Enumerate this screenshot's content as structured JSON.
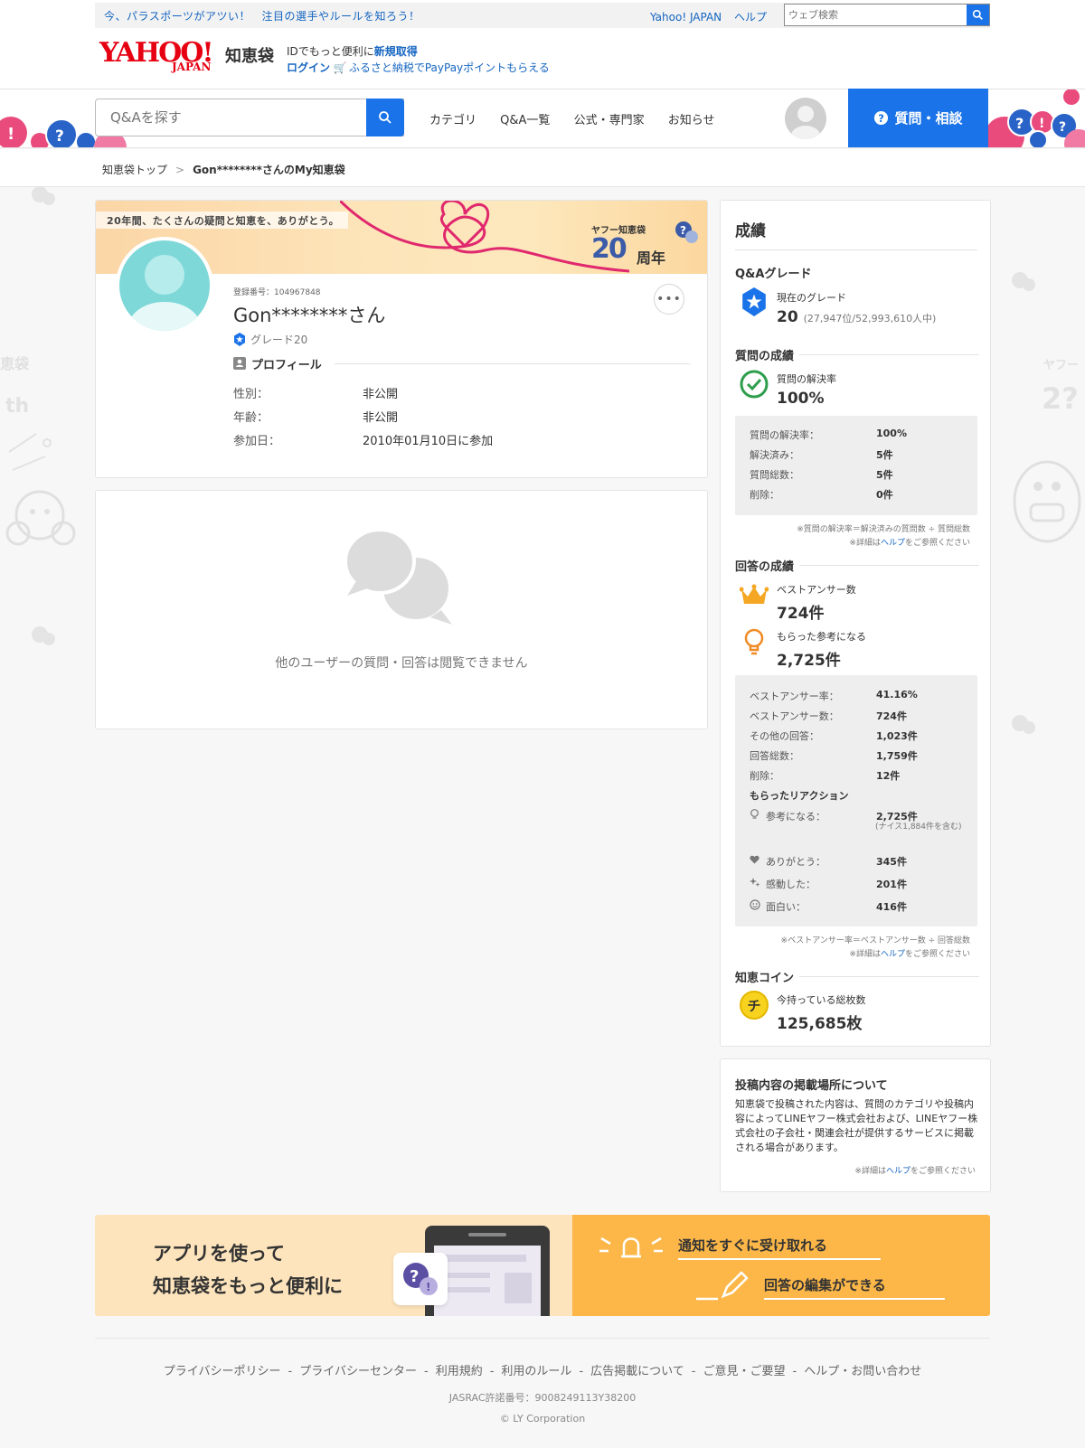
{
  "header": {
    "promo_text": "今、パラスポーツがアツい！　注目の選手やルールを知ろう！",
    "util_links": [
      "Yahoo! JAPAN",
      "ヘルプ"
    ],
    "web_search_placeholder": "ウェブ検索",
    "logo_yahoo": "YAHOO!",
    "logo_japan": "JAPAN",
    "logo_service": "知恵袋",
    "login_line1_prefix": "IDでもっと便利に",
    "login_line1_link": "新規取得",
    "login_line2_link": "ログイン",
    "login_line2_promo": "ふるさと納税でPayPayポイントもらえる"
  },
  "nav": {
    "search_placeholder": "Q&Aを探す",
    "links": [
      "カテゴリ",
      "Q&A一覧",
      "公式・専門家",
      "お知らせ"
    ],
    "ask_button": "質問・相談"
  },
  "breadcrumb": {
    "home": "知恵袋トップ",
    "separator": ">",
    "current": "Gon********さんのMy知恵袋"
  },
  "profile": {
    "banner_text": "20年間、たくさんの疑問と知恵を、ありがとう。",
    "banner_brand": "ヤフー知恵袋",
    "banner_number": "20",
    "banner_year": "周年",
    "registration": "登録番号：104967848",
    "name": "Gon********さん",
    "grade": "グレード20",
    "section_title": "プロフィール",
    "rows": [
      {
        "label": "性別：",
        "value": "非公開"
      },
      {
        "label": "年齢：",
        "value": "非公開"
      },
      {
        "label": "参加日：",
        "value": "2010年01月10日に参加"
      }
    ],
    "more_icon": "more-horizontal-icon"
  },
  "private_notice": "他のユーザーの質問・回答は閲覧できません",
  "stats": {
    "title": "成績",
    "qa_grade": {
      "heading": "Q&Aグレード",
      "label": "現在のグレード",
      "value": "20",
      "rank": "(27,947位/52,993,610人中)"
    },
    "questions": {
      "heading": "質問の成績",
      "label": "質問の解決率",
      "value": "100%",
      "rows": [
        {
          "label": "質問の解決率：",
          "value": "100%"
        },
        {
          "label": "解決済み：",
          "value": "5件"
        },
        {
          "label": "質問総数：",
          "value": "5件"
        },
        {
          "label": "削除：",
          "value": "0件"
        }
      ],
      "note1": "※質問の解決率＝解決済みの質問数 ÷ 質問総数",
      "note2_prefix": "※詳細は",
      "note2_link": "ヘルプ",
      "note2_suffix": "をご参照ください"
    },
    "answers": {
      "heading": "回答の成績",
      "best_label": "ベストアンサー数",
      "best_value": "724件",
      "helpful_label": "もらった参考になる",
      "helpful_value": "2,725件",
      "rows": [
        {
          "label": "ベストアンサー率：",
          "value": "41.16%"
        },
        {
          "label": "ベストアンサー数：",
          "value": "724件"
        },
        {
          "label": "その他の回答：",
          "value": "1,023件"
        },
        {
          "label": "回答総数：",
          "value": "1,759件"
        },
        {
          "label": "削除：",
          "value": "12件"
        }
      ],
      "reactions_heading": "もらったリアクション",
      "reactions": [
        {
          "label": "参考になる：",
          "value": "2,725件",
          "sub": "(ナイス1,884件を含む)"
        },
        {
          "label": "ありがとう：",
          "value": "345件"
        },
        {
          "label": "感動した：",
          "value": "201件"
        },
        {
          "label": "面白い：",
          "value": "416件"
        }
      ],
      "note1": "※ベストアンサー率＝ベストアンサー数 ÷ 回答総数",
      "note2_prefix": "※詳細は",
      "note2_link": "ヘルプ",
      "note2_suffix": "をご参照ください"
    },
    "coins": {
      "heading": "知恵コイン",
      "icon_char": "チ",
      "label": "今持っている総枚数",
      "value": "125,685枚"
    }
  },
  "info": {
    "title": "投稿内容の掲載場所について",
    "body": "知恵袋で投稿された内容は、質問のカテゴリや投稿内容によってLINEヤフー株式会社および、LINEヤフー株式会社の子会社・関連会社が提供するサービスに掲載される場合があります。",
    "note_prefix": "※詳細は",
    "note_link": "ヘルプ",
    "note_suffix": "をご参照ください"
  },
  "app_banner": {
    "title_line1": "アプリを使って",
    "title_line2": "知恵袋をもっと便利に",
    "feature1": "通知をすぐに受け取れる",
    "feature2": "回答の編集ができる"
  },
  "footer": {
    "links": [
      "プライバシーポリシー",
      "プライバシーセンター",
      "利用規約",
      "利用のルール",
      "広告掲載について",
      "ご意見・ご要望",
      "ヘルプ・お問い合わせ"
    ],
    "separator": "-",
    "jasrac": "JASRAC許諾番号：9008249113Y38200",
    "copyright": "© LY Corporation"
  },
  "colors": {
    "brand_red": "#e60012",
    "accent_blue": "#1a73e8",
    "link_blue": "#1565c0",
    "app_orange": "#fcb748"
  }
}
